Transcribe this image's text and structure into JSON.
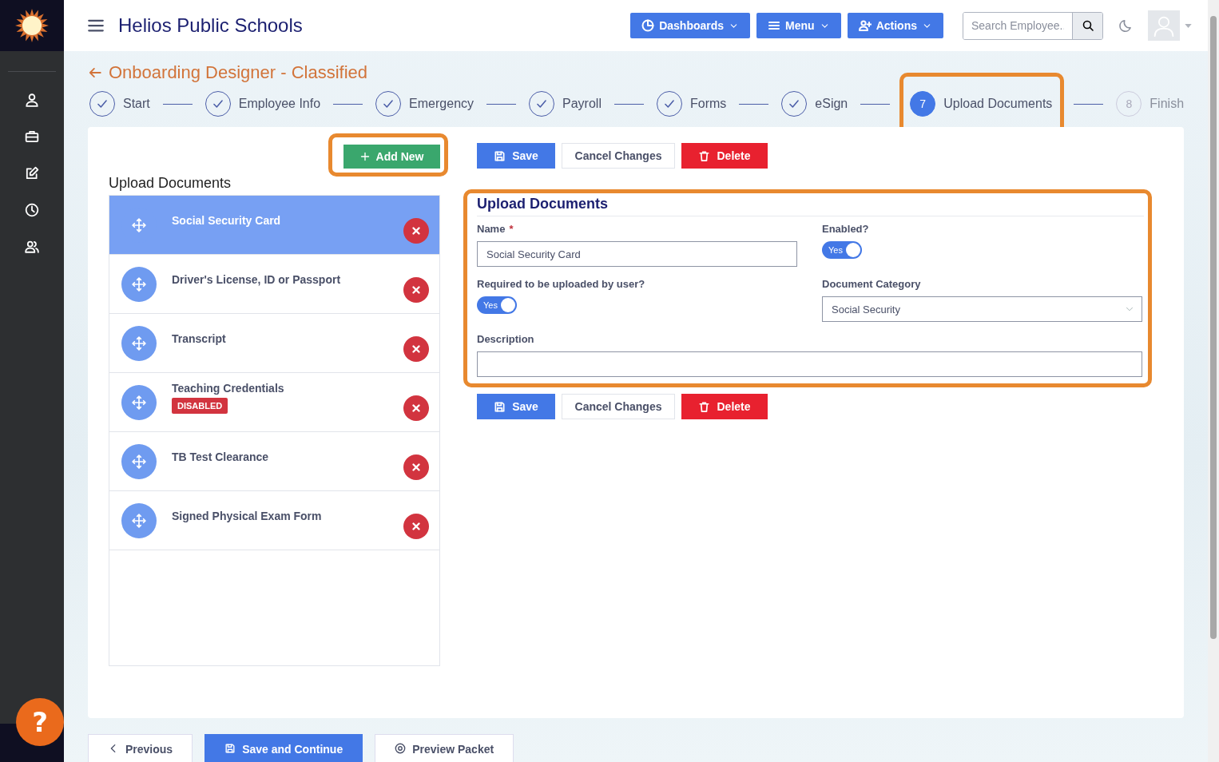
{
  "app": {
    "title": "Helios Public Schools"
  },
  "sidebar": {
    "items": [
      {
        "kind": "person"
      },
      {
        "kind": "briefcase"
      },
      {
        "kind": "edit"
      },
      {
        "kind": "clock"
      },
      {
        "kind": "people"
      }
    ]
  },
  "nav_buttons": [
    {
      "label": "Dashboards",
      "kind": "dashboards"
    },
    {
      "label": "Menu",
      "kind": "menu"
    },
    {
      "label": "Actions",
      "kind": "actions"
    }
  ],
  "search": {
    "placeholder": "Search Employee.."
  },
  "page": {
    "title": "Onboarding Designer - Classified"
  },
  "steps": [
    {
      "label": "Start",
      "kind": "done",
      "highlighted": false
    },
    {
      "label": "Employee Info",
      "kind": "done",
      "highlighted": false
    },
    {
      "label": "Emergency",
      "kind": "done",
      "highlighted": false
    },
    {
      "label": "Payroll",
      "kind": "done",
      "highlighted": false
    },
    {
      "label": "Forms",
      "kind": "done",
      "highlighted": false
    },
    {
      "label": "eSign",
      "kind": "done",
      "highlighted": false
    },
    {
      "number": "7",
      "label": "Upload Documents",
      "kind": "current",
      "highlighted": true
    },
    {
      "number": "8",
      "label": "Finish",
      "kind": "pending",
      "highlighted": false
    }
  ],
  "add_button": {
    "label": "Add New",
    "highlighted": true
  },
  "list": {
    "title": "Upload Documents",
    "items": [
      {
        "name": "Social Security Card",
        "selected": true
      },
      {
        "name": "Driver's License, ID or Passport",
        "selected": false
      },
      {
        "name": "Transcript",
        "selected": false
      },
      {
        "name": "Teaching Credentials",
        "selected": false,
        "badge": "DISABLED"
      },
      {
        "name": "TB Test Clearance",
        "selected": false
      },
      {
        "name": "Signed Physical Exam Form",
        "selected": false
      }
    ]
  },
  "actions_top": [
    {
      "label": "Save",
      "kind": "save"
    },
    {
      "label": "Cancel Changes",
      "kind": "cancel"
    },
    {
      "label": "Delete",
      "kind": "delete"
    }
  ],
  "form": {
    "title": "Upload Documents",
    "highlighted": true,
    "name": {
      "label": "Name",
      "required_mark": "*",
      "value": "Social Security Card"
    },
    "enabled": {
      "label": "Enabled?",
      "on": true,
      "text": "Yes"
    },
    "required_upload": {
      "label": "Required to be uploaded by user?",
      "on": true,
      "text": "Yes"
    },
    "category": {
      "label": "Document Category",
      "value": "Social Security"
    },
    "description": {
      "label": "Description"
    }
  },
  "actions_bottom": [
    {
      "label": "Save",
      "kind": "save"
    },
    {
      "label": "Cancel Changes",
      "kind": "cancel"
    },
    {
      "label": "Delete",
      "kind": "delete"
    }
  ],
  "footer_buttons": [
    {
      "label": "Previous",
      "kind": "previous"
    },
    {
      "label": "Save and Continue",
      "kind": "save"
    },
    {
      "label": "Preview Packet",
      "kind": "preview"
    }
  ],
  "help": {
    "label": "?"
  }
}
